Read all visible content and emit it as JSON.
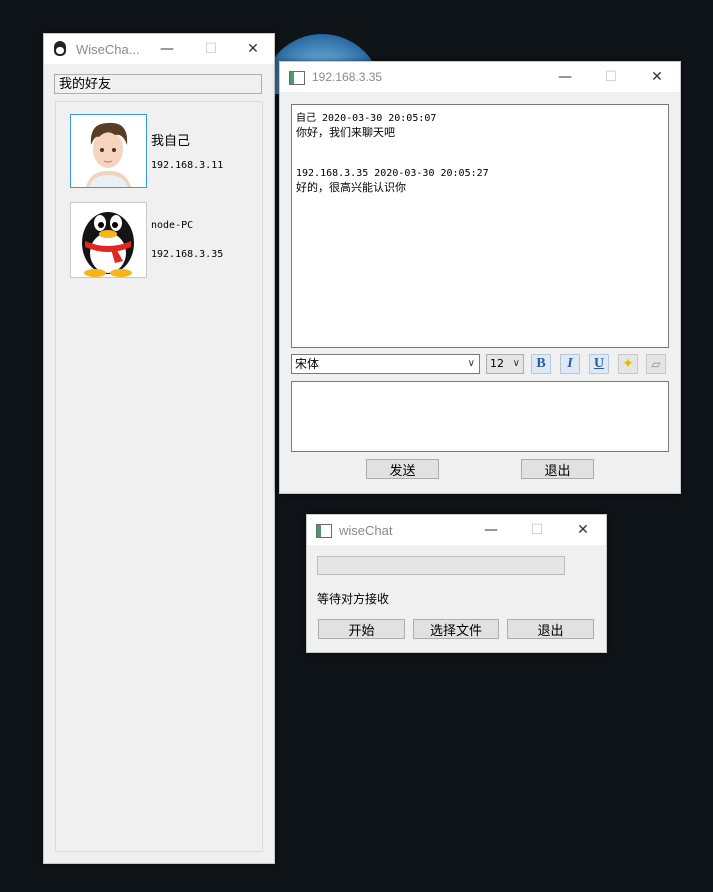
{
  "friends_window": {
    "title": "WiseCha...",
    "header": "我的好友",
    "contacts": [
      {
        "name": "我自己",
        "ip": "192.168.3.11"
      },
      {
        "name": "node-PC",
        "ip": "192.168.3.35"
      }
    ]
  },
  "chat_window": {
    "title": "192.168.3.35",
    "messages": [
      {
        "meta": "自己 2020-03-30 20:05:07",
        "text": "你好，我们来聊天吧"
      },
      {
        "meta": "192.168.3.35 2020-03-30 20:05:27",
        "text": "好的，很高兴能认识你"
      }
    ],
    "font_select": "宋体",
    "size_select": "12",
    "send_label": "发送",
    "exit_label": "退出"
  },
  "file_window": {
    "title": "wiseChat",
    "status": "等待对方接收",
    "start_label": "开始",
    "choose_label": "选择文件",
    "exit_label": "退出"
  },
  "window_controls": {
    "minimize": "—",
    "maximize": "☐",
    "close": "✕"
  }
}
